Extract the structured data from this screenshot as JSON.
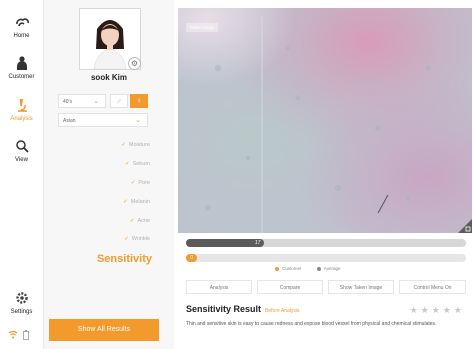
{
  "nav": {
    "items": [
      {
        "label": "Home",
        "icon": "cloud-icon"
      },
      {
        "label": "Customer",
        "icon": "person-icon"
      },
      {
        "label": "Analysis",
        "icon": "microscope-icon",
        "active": true
      },
      {
        "label": "View",
        "icon": "magnifier-icon"
      }
    ],
    "settings_label": "Settings",
    "status_icons": [
      "wifi-icon",
      "battery-icon"
    ]
  },
  "profile": {
    "name": "sook Kim",
    "age": "40's",
    "ethnicity": "Asian",
    "gender_male_icon": "male-icon",
    "gender_female_icon": "female-icon"
  },
  "metrics": [
    "Moisture",
    "Sebum",
    "Pore",
    "Melanin",
    "Acne",
    "Wrinkle"
  ],
  "selected_metric": "Sensitivity",
  "show_all_label": "Show All Results",
  "image": {
    "tag": "Taken Image"
  },
  "bars": {
    "customer_value": "17",
    "customer_fraction": 0.28,
    "average_value": "0",
    "average_fraction": 0.04
  },
  "legend": {
    "customer": "Customer",
    "average": "Average"
  },
  "buttons": [
    "Analysis",
    "Compare",
    "Show Taken Image",
    "Control Menu On"
  ],
  "result": {
    "title": "Sensitivity Result",
    "subtitle": "Before Analysis",
    "description": "Thin and sensitive skin is easy to cause redness and expose blood vessel from physical and chemical stimulates.",
    "stars": "★★★★★"
  },
  "colors": {
    "accent": "#f39a2c",
    "dark_bar": "#5b5b5b"
  }
}
